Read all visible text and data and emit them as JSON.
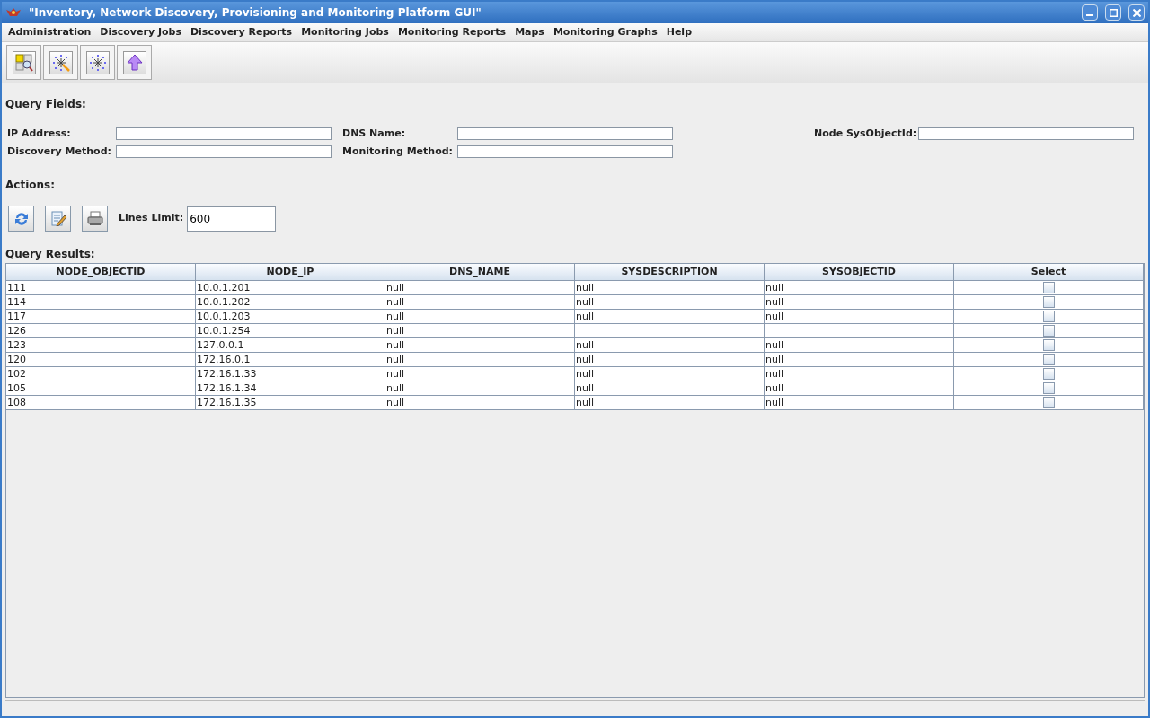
{
  "window": {
    "title": "\"Inventory, Network Discovery, Provisioning and Monitoring Platform GUI\""
  },
  "menu": [
    "Administration",
    "Discovery Jobs",
    "Discovery Reports",
    "Monitoring Jobs",
    "Monitoring Reports",
    "Maps",
    "Monitoring Graphs",
    "Help"
  ],
  "toolbar": [
    {
      "kind": "search"
    },
    {
      "kind": "wand"
    },
    {
      "kind": "network"
    },
    {
      "kind": "upload"
    }
  ],
  "query_fields": {
    "title": "Query Fields:",
    "fields": [
      {
        "label": "IP Address:"
      },
      {
        "label": "DNS Name:"
      },
      {
        "label": "Node SysObjectId:"
      },
      {
        "label": "Discovery Method:"
      },
      {
        "label": "Monitoring Method:"
      }
    ]
  },
  "actions": {
    "title": "Actions:",
    "buttons": [
      {
        "kind": "refresh"
      },
      {
        "kind": "edit"
      },
      {
        "kind": "print"
      }
    ],
    "lines_limit": {
      "label": "Lines Limit:",
      "value": "600"
    }
  },
  "results": {
    "title": "Query Results:",
    "columns": [
      "NODE_OBJECTID",
      "NODE_IP",
      "DNS_NAME",
      "SYSDESCRIPTION",
      "SYSOBJECTID",
      "Select"
    ],
    "rows": [
      {
        "cells": [
          "111",
          "10.0.1.201",
          "null",
          "null",
          "null"
        ],
        "selected": false
      },
      {
        "cells": [
          "114",
          "10.0.1.202",
          "null",
          "null",
          "null"
        ],
        "selected": false
      },
      {
        "cells": [
          "117",
          "10.0.1.203",
          "null",
          "null",
          "null"
        ],
        "selected": false
      },
      {
        "cells": [
          "126",
          "10.0.1.254",
          "null",
          null,
          null
        ],
        "selected": false
      },
      {
        "cells": [
          "123",
          "127.0.0.1",
          "null",
          "null",
          "null"
        ],
        "selected": false
      },
      {
        "cells": [
          "120",
          "172.16.0.1",
          "null",
          "null",
          "null"
        ],
        "selected": false
      },
      {
        "cells": [
          "102",
          "172.16.1.33",
          "null",
          "null",
          "null"
        ],
        "selected": false
      },
      {
        "cells": [
          "105",
          "172.16.1.34",
          "null",
          "null",
          "null"
        ],
        "selected": false
      },
      {
        "cells": [
          "108",
          "172.16.1.35",
          "null",
          "null",
          "null"
        ],
        "selected": false
      }
    ]
  }
}
